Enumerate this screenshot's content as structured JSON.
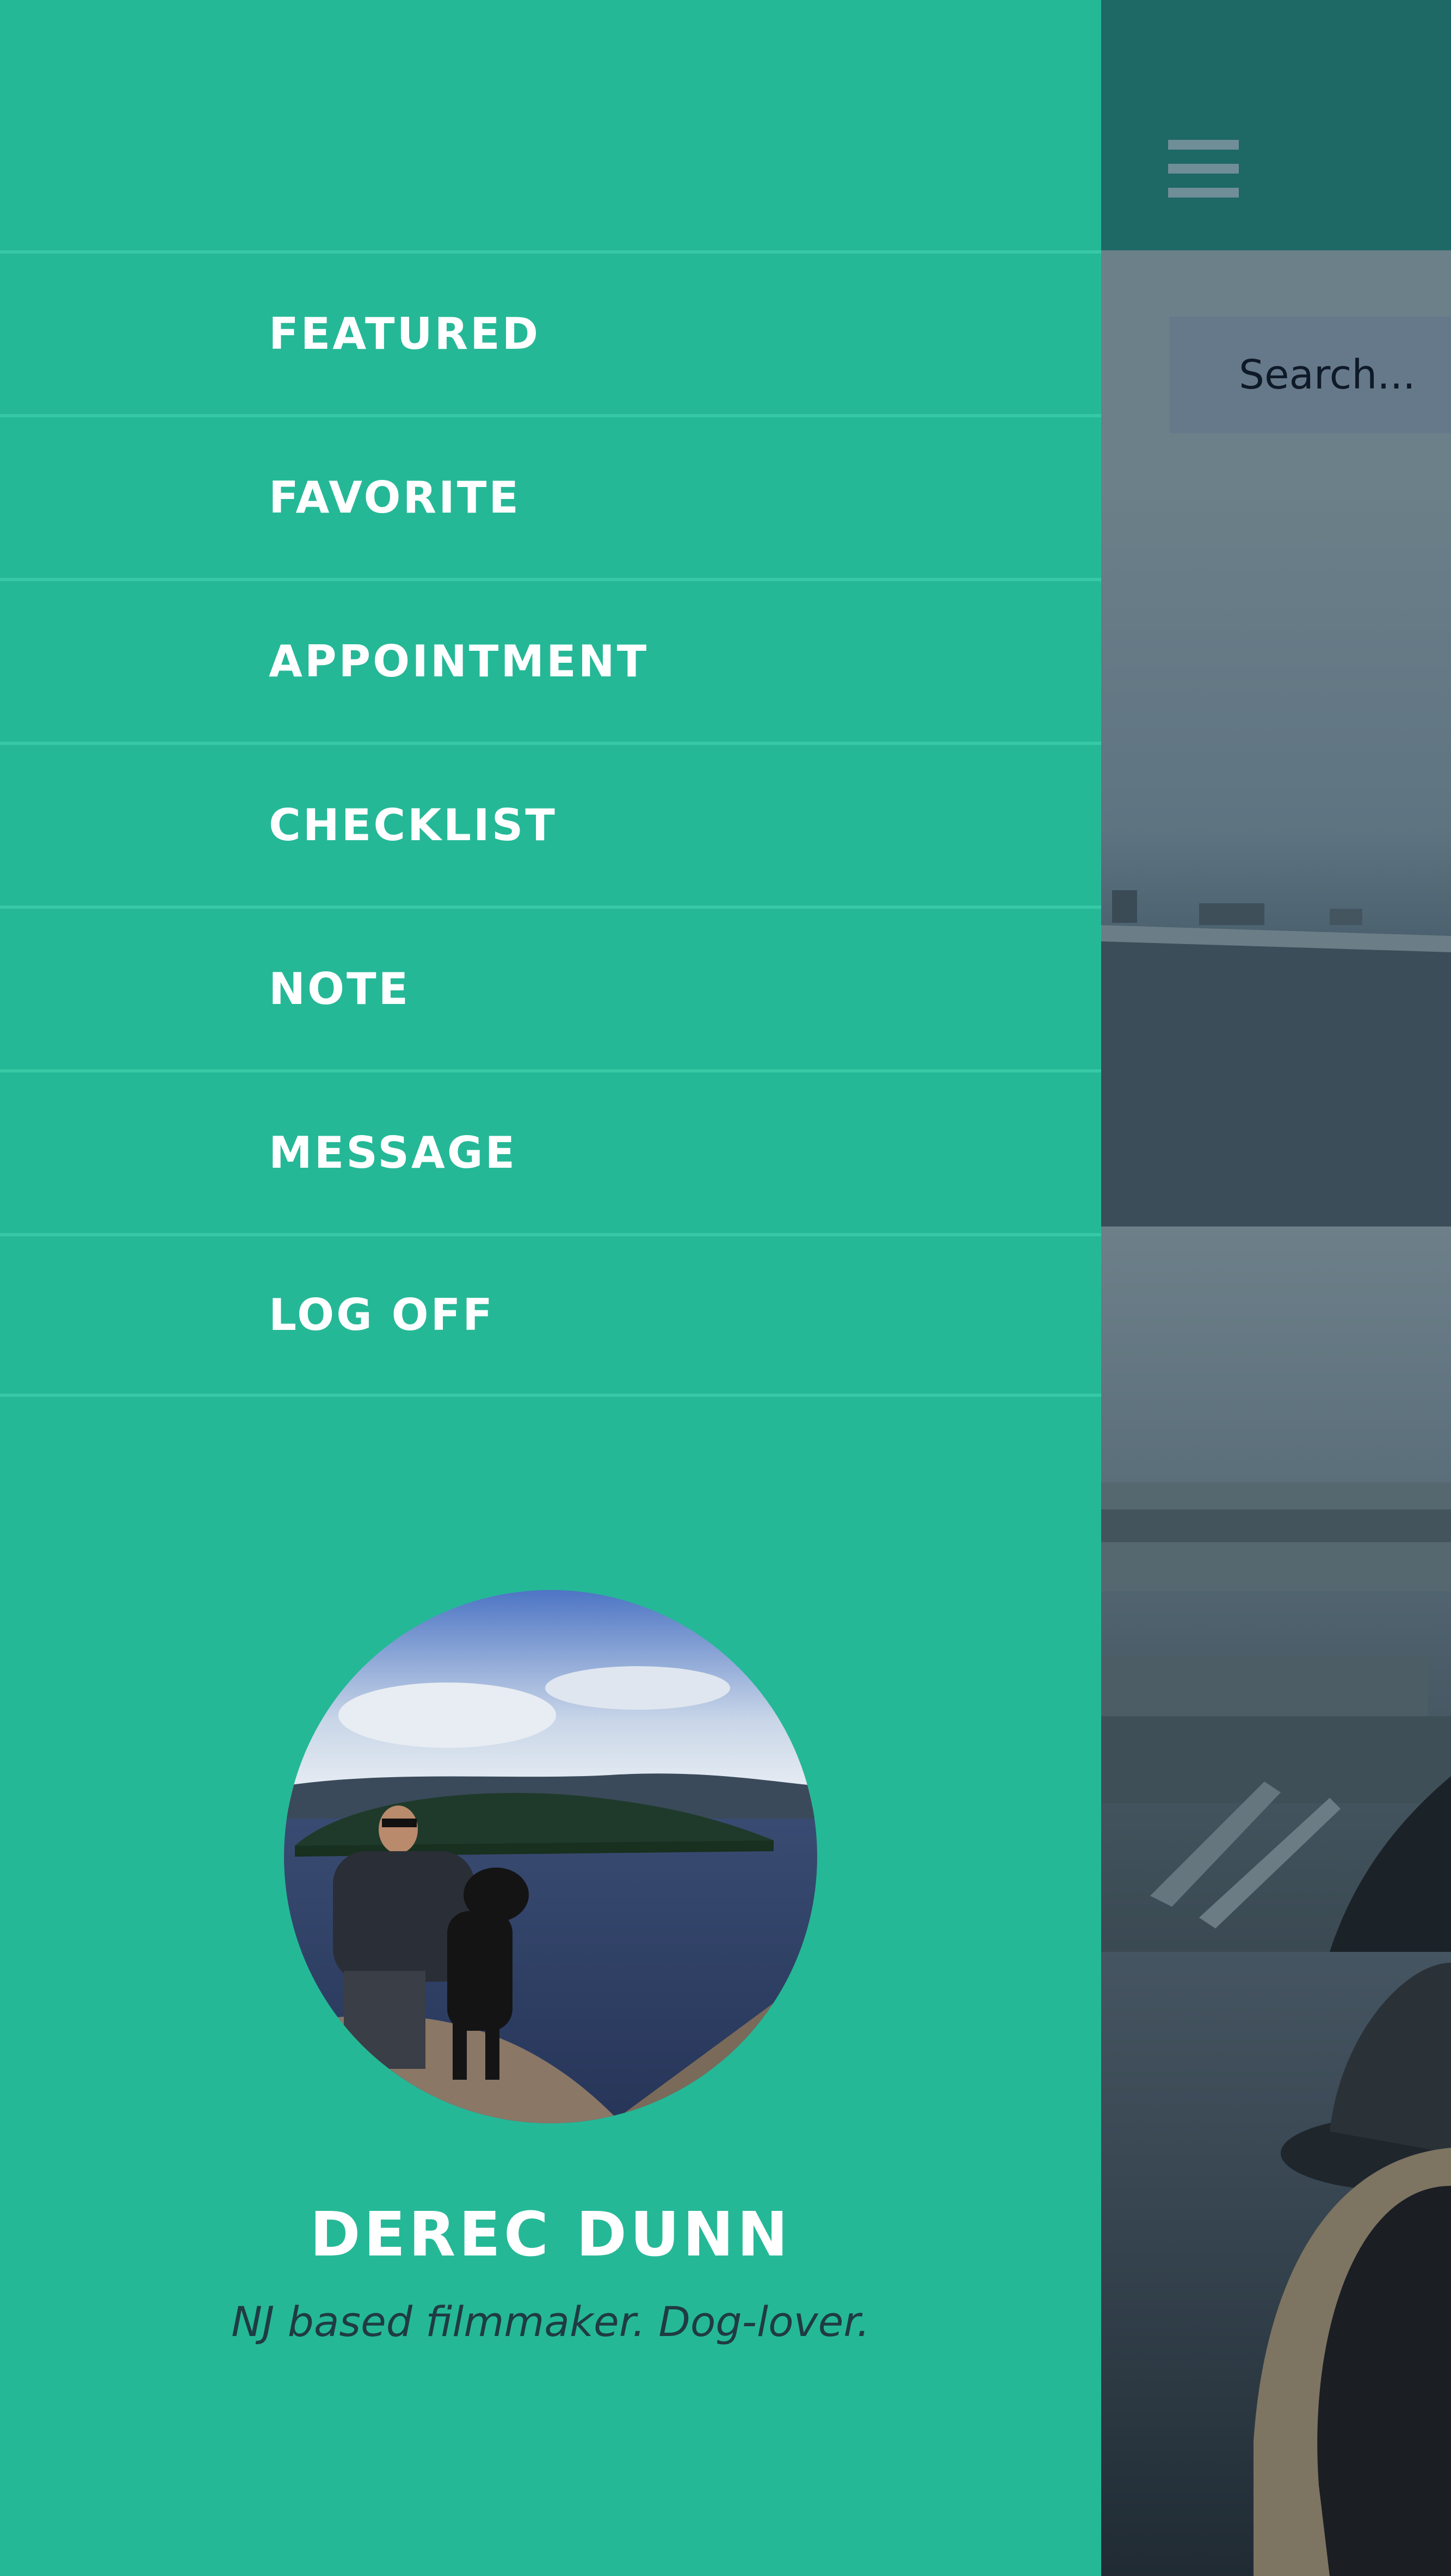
{
  "topbar": {
    "menu_icon": "hamburger-menu-icon"
  },
  "search": {
    "placeholder": "Search..."
  },
  "menu": {
    "items": [
      {
        "label": "FEATURED"
      },
      {
        "label": "FAVORITE"
      },
      {
        "label": "APPOINTMENT"
      },
      {
        "label": "CHECKLIST"
      },
      {
        "label": "NOTE"
      },
      {
        "label": "MESSAGE"
      },
      {
        "label": "LOG OFF"
      }
    ]
  },
  "profile": {
    "name": "DEREC DUNN",
    "bio": "NJ based filmmaker. Dog-lover."
  },
  "colors": {
    "drawer": "#25b897",
    "divider": "#37c8a6",
    "topbar": "#1e6866",
    "text_light": "#ffffff",
    "bio_text": "#1f3b44"
  }
}
